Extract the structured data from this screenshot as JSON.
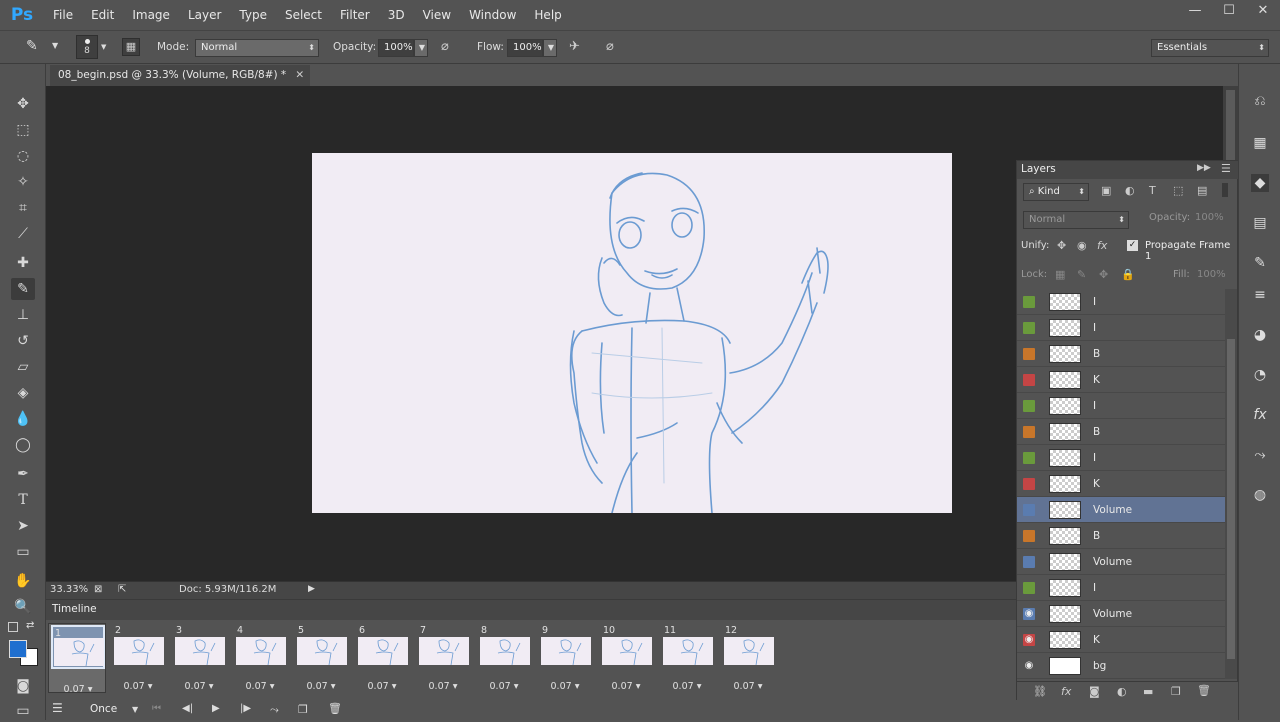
{
  "app": {
    "logo": "Ps"
  },
  "menu": [
    "File",
    "Edit",
    "Image",
    "Layer",
    "Type",
    "Select",
    "Filter",
    "3D",
    "View",
    "Window",
    "Help"
  ],
  "window_controls": [
    "—",
    "☐",
    "✕"
  ],
  "options_bar": {
    "brush_size": "8",
    "mode_label": "Mode:",
    "mode_value": "Normal",
    "opacity_label": "Opacity:",
    "opacity_value": "100%",
    "flow_label": "Flow:",
    "flow_value": "100%",
    "workspace": "Essentials"
  },
  "document": {
    "tab_title": "08_begin.psd @ 33.3% (Volume, RGB/8#) *",
    "zoom": "33.33%",
    "doc_size": "Doc: 5.93M/116.2M"
  },
  "timeline": {
    "title": "Timeline",
    "frames": [
      {
        "num": "1",
        "dur": "0.07"
      },
      {
        "num": "2",
        "dur": "0.07"
      },
      {
        "num": "3",
        "dur": "0.07"
      },
      {
        "num": "4",
        "dur": "0.07"
      },
      {
        "num": "5",
        "dur": "0.07"
      },
      {
        "num": "6",
        "dur": "0.07"
      },
      {
        "num": "7",
        "dur": "0.07"
      },
      {
        "num": "8",
        "dur": "0.07"
      },
      {
        "num": "9",
        "dur": "0.07"
      },
      {
        "num": "10",
        "dur": "0.07"
      },
      {
        "num": "11",
        "dur": "0.07"
      },
      {
        "num": "12",
        "dur": "0.07"
      }
    ],
    "loop": "Once"
  },
  "layers_panel": {
    "title": "Layers",
    "filter_kind": "Kind",
    "blend_mode": "Normal",
    "opacity_label": "Opacity:",
    "opacity_value": "100%",
    "unify_label": "Unify:",
    "propagate_label": "Propagate Frame 1",
    "lock_label": "Lock:",
    "fill_label": "Fill:",
    "fill_value": "100%",
    "layers": [
      {
        "name": "I",
        "color": "#6a9a3c",
        "eye": false
      },
      {
        "name": "I",
        "color": "#6a9a3c",
        "eye": false
      },
      {
        "name": "B",
        "color": "#c8762a",
        "eye": false
      },
      {
        "name": "K",
        "color": "#c44545",
        "eye": false
      },
      {
        "name": "I",
        "color": "#6a9a3c",
        "eye": false
      },
      {
        "name": "B",
        "color": "#c8762a",
        "eye": false
      },
      {
        "name": "I",
        "color": "#6a9a3c",
        "eye": false
      },
      {
        "name": "K",
        "color": "#c44545",
        "eye": false
      },
      {
        "name": "Volume",
        "color": "#5a7cb0",
        "eye": false,
        "active": true
      },
      {
        "name": "B",
        "color": "#c8762a",
        "eye": false
      },
      {
        "name": "Volume",
        "color": "#5a7cb0",
        "eye": false
      },
      {
        "name": "I",
        "color": "#6a9a3c",
        "eye": false
      },
      {
        "name": "Volume",
        "color": "#5a7cb0",
        "eye": true
      },
      {
        "name": "K",
        "color": "#c44545",
        "eye": true
      },
      {
        "name": "bg",
        "color": "none",
        "eye": true,
        "white": true
      }
    ]
  },
  "colors": {
    "accent": "#31a8ff",
    "active_layer": "#617394",
    "sketch": "#6b9bd2"
  }
}
